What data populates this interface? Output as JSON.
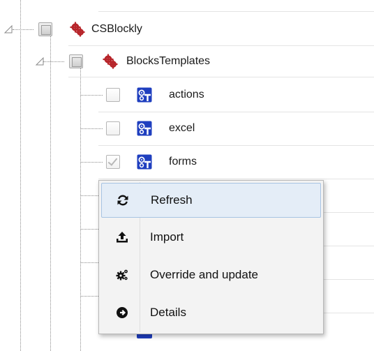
{
  "tree": {
    "root": {
      "label": "CSBlockly",
      "icon": "gears-icon"
    },
    "child": {
      "label": "BlocksTemplates",
      "icon": "gears-icon"
    },
    "items": [
      {
        "label": "actions",
        "icon": "template-icon",
        "checked": false
      },
      {
        "label": "excel",
        "icon": "template-icon",
        "checked": false
      },
      {
        "label": "forms",
        "icon": "template-icon",
        "checked": true
      }
    ]
  },
  "context_menu": {
    "items": [
      {
        "label": "Refresh",
        "icon": "refresh-icon",
        "active": true
      },
      {
        "label": "Import",
        "icon": "upload-icon",
        "active": false
      },
      {
        "label": "Override and update",
        "icon": "cogs-icon",
        "active": false
      },
      {
        "label": "Details",
        "icon": "arrow-circle-right-icon",
        "active": false
      }
    ]
  },
  "colors": {
    "gear_red": "#b7252a",
    "template_blue": "#1f3fbf",
    "menu_highlight": "#e4edf7",
    "menu_highlight_border": "#a7c3e2"
  }
}
